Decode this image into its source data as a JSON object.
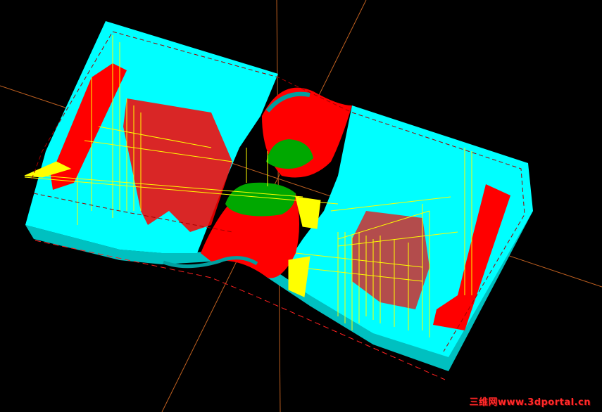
{
  "viewport": {
    "background_color": "#000000",
    "colors": {
      "stock_face": "#00ffff",
      "stock_side": "#00c8c8",
      "cavity_wall": "#ff0000",
      "core_surface": "#00aa00",
      "toolpath": "#ffff00",
      "crosshair_axis": "#c06020",
      "boundary_dash": "#ff2020",
      "dashed_outline": "#a00000"
    },
    "icons": [
      "crosshair-axis",
      "dashed-bounding-box"
    ]
  },
  "watermark": {
    "text": "三维网www.3dportal.cn"
  }
}
